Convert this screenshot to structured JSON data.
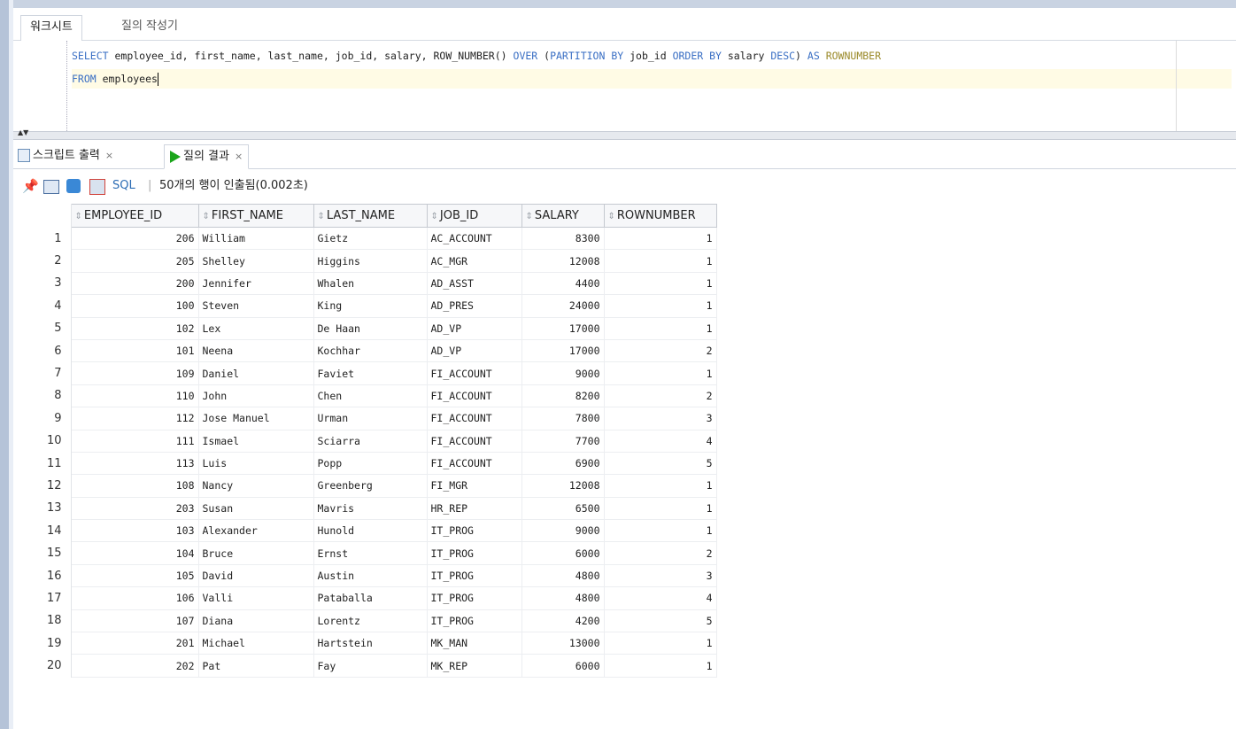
{
  "worksheet_tabs": {
    "active": "워크시트",
    "inactive": "질의 작성기"
  },
  "editor": {
    "line1": [
      {
        "t": "SELECT",
        "c": "kw"
      },
      {
        "t": " employee_id, first_name, last_name, job_id, salary, ROW_NUMBER() ",
        "c": ""
      },
      {
        "t": "OVER",
        "c": "kw"
      },
      {
        "t": " (",
        "c": ""
      },
      {
        "t": "PARTITION BY",
        "c": "kw"
      },
      {
        "t": " job_id ",
        "c": ""
      },
      {
        "t": "ORDER BY",
        "c": "kw"
      },
      {
        "t": " salary ",
        "c": ""
      },
      {
        "t": "DESC",
        "c": "kw"
      },
      {
        "t": ") ",
        "c": ""
      },
      {
        "t": "AS",
        "c": "kw"
      },
      {
        "t": " ",
        "c": ""
      },
      {
        "t": "ROWNUMBER",
        "c": "kw2"
      }
    ],
    "line2_kw": "FROM",
    "line2_rest": " employees"
  },
  "result_tabs": {
    "script_output": "스크립트 출력",
    "query_result": "질의 결과",
    "close": "×"
  },
  "toolbar": {
    "sql_label": "SQL",
    "separator": "|",
    "status": "50개의 행이 인출됨(0.002초)"
  },
  "columns": [
    "EMPLOYEE_ID",
    "FIRST_NAME",
    "LAST_NAME",
    "JOB_ID",
    "SALARY",
    "ROWNUMBER"
  ],
  "rows": [
    [
      "1",
      "206",
      "William",
      "Gietz",
      "AC_ACCOUNT",
      "8300",
      "1"
    ],
    [
      "2",
      "205",
      "Shelley",
      "Higgins",
      "AC_MGR",
      "12008",
      "1"
    ],
    [
      "3",
      "200",
      "Jennifer",
      "Whalen",
      "AD_ASST",
      "4400",
      "1"
    ],
    [
      "4",
      "100",
      "Steven",
      "King",
      "AD_PRES",
      "24000",
      "1"
    ],
    [
      "5",
      "102",
      "Lex",
      "De Haan",
      "AD_VP",
      "17000",
      "1"
    ],
    [
      "6",
      "101",
      "Neena",
      "Kochhar",
      "AD_VP",
      "17000",
      "2"
    ],
    [
      "7",
      "109",
      "Daniel",
      "Faviet",
      "FI_ACCOUNT",
      "9000",
      "1"
    ],
    [
      "8",
      "110",
      "John",
      "Chen",
      "FI_ACCOUNT",
      "8200",
      "2"
    ],
    [
      "9",
      "112",
      "Jose Manuel",
      "Urman",
      "FI_ACCOUNT",
      "7800",
      "3"
    ],
    [
      "10",
      "111",
      "Ismael",
      "Sciarra",
      "FI_ACCOUNT",
      "7700",
      "4"
    ],
    [
      "11",
      "113",
      "Luis",
      "Popp",
      "FI_ACCOUNT",
      "6900",
      "5"
    ],
    [
      "12",
      "108",
      "Nancy",
      "Greenberg",
      "FI_MGR",
      "12008",
      "1"
    ],
    [
      "13",
      "203",
      "Susan",
      "Mavris",
      "HR_REP",
      "6500",
      "1"
    ],
    [
      "14",
      "103",
      "Alexander",
      "Hunold",
      "IT_PROG",
      "9000",
      "1"
    ],
    [
      "15",
      "104",
      "Bruce",
      "Ernst",
      "IT_PROG",
      "6000",
      "2"
    ],
    [
      "16",
      "105",
      "David",
      "Austin",
      "IT_PROG",
      "4800",
      "3"
    ],
    [
      "17",
      "106",
      "Valli",
      "Pataballa",
      "IT_PROG",
      "4800",
      "4"
    ],
    [
      "18",
      "107",
      "Diana",
      "Lorentz",
      "IT_PROG",
      "4200",
      "5"
    ],
    [
      "19",
      "201",
      "Michael",
      "Hartstein",
      "MK_MAN",
      "13000",
      "1"
    ],
    [
      "20",
      "202",
      "Pat",
      "Fay",
      "MK_REP",
      "6000",
      "1"
    ]
  ]
}
